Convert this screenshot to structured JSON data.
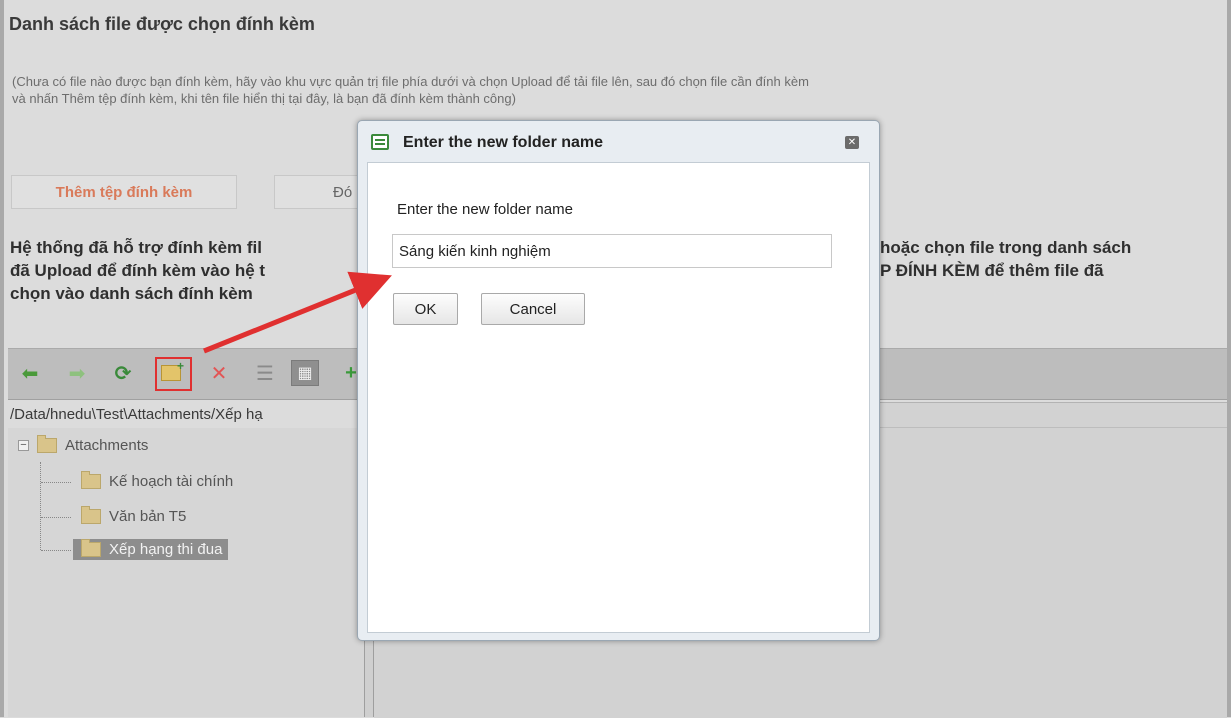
{
  "page": {
    "section_title": "Danh sách file được chọn đính kèm",
    "hint_line1": "(Chưa có file nào được bạn đính kèm, hãy vào khu vực quản trị file phía dưới và chọn Upload để tải file lên, sau đó chọn file cần đính kèm",
    "hint_line2": "và nhấn Thêm tệp đính kèm, khi tên file hiển thị tại đây, là bạn đã đính kèm thành công)",
    "attach_button": "Thêm tệp đính kèm",
    "second_button_partial": "Đó",
    "info_left_line1": "Hệ thống đã hỗ trợ đính kèm fil",
    "info_left_line2": "đã Upload để đính kèm vào hệ t",
    "info_left_line3": "chọn vào danh sách đính kèm",
    "info_right_line1": "hoặc chọn file trong danh sách",
    "info_right_line2": "P ĐÍNH KÈM để thêm file đã"
  },
  "file_manager": {
    "toolbar_icons": [
      "back-arrow-icon",
      "forward-arrow-icon",
      "refresh-icon",
      "new-folder-icon",
      "delete-icon",
      "list-view-icon",
      "thumbnail-view-icon",
      "add-icon"
    ],
    "path": "/Data/hnedu\\Test\\Attachments/Xếp hạ",
    "tree": {
      "root": "Attachments",
      "children": [
        "Kế hoạch tài chính",
        "Văn bản T5",
        "Xếp hạng thi đua"
      ],
      "selected": "Xếp hạng thi đua"
    }
  },
  "dialog": {
    "title": "Enter the new folder name",
    "label": "Enter the new folder name",
    "input_value": "Sáng kiến kinh nghiệm",
    "ok_label": "OK",
    "cancel_label": "Cancel"
  },
  "colors": {
    "annotation_red": "#e03030",
    "attach_button_text": "#d97a5a"
  }
}
